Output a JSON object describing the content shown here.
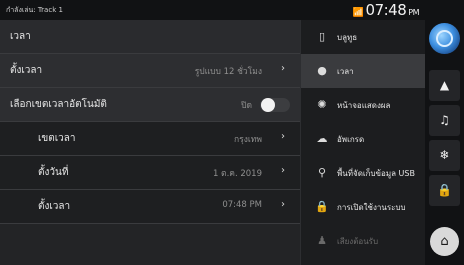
{
  "status_bar": {
    "now_playing": "กำลังเล่น: Track 1",
    "signal_icon": "signal-icon",
    "time": "07:48",
    "ampm": "PM"
  },
  "settings": {
    "section_title": "เวลา",
    "rows": [
      {
        "label": "ตั้งเวลา",
        "value": "รูปแบบ 12 ชั่วโมง"
      },
      {
        "label": "เลือกเขตเวลาอัตโนมัติ",
        "value": "ปิด",
        "toggle_on": false
      },
      {
        "label": "เขตเวลา",
        "value": "กรุงเทพ"
      },
      {
        "label": "ตั้งวันที่",
        "value": "1 ต.ค. 2019"
      },
      {
        "label": "ตั้งเวลา",
        "value": "07:48 PM"
      }
    ]
  },
  "menu": {
    "items": [
      {
        "label": "บลูทูธ",
        "icon": "bluetooth-icon"
      },
      {
        "label": "เวลา",
        "icon": "clock-icon",
        "active": true
      },
      {
        "label": "หน้าจอแสดงผล",
        "icon": "brightness-icon"
      },
      {
        "label": "อัพเกรด",
        "icon": "cloud-upgrade-icon"
      },
      {
        "label": "พื้นที่จัดเก็บข้อมูล USB",
        "icon": "usb-icon"
      },
      {
        "label": "การเปิดใช้งานระบบ",
        "icon": "lock-icon"
      },
      {
        "label": "เสียงต้อนรับ",
        "icon": "person-icon",
        "dim": true
      }
    ]
  },
  "rail": {
    "buttons": [
      "navigation-icon",
      "music-icon",
      "climate-icon",
      "lock-icon"
    ],
    "home_icon": "home-icon"
  }
}
